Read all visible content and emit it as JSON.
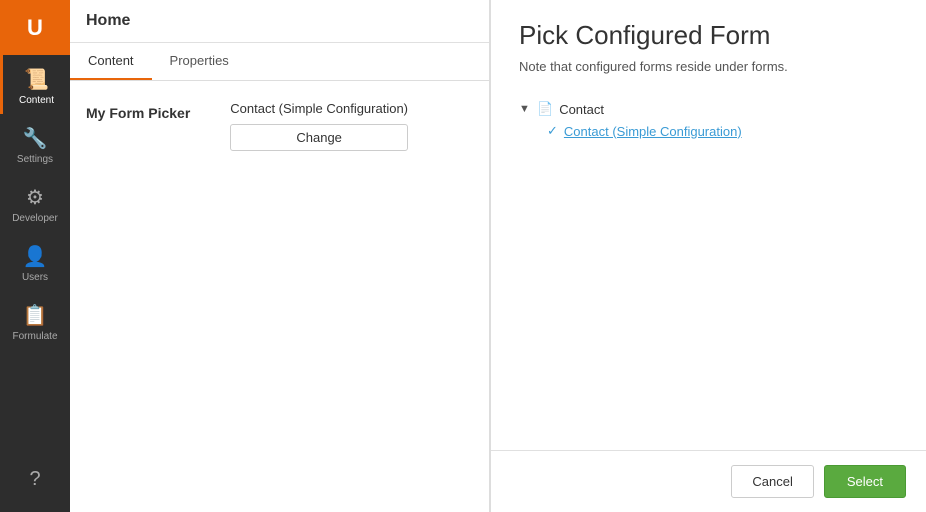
{
  "sidebar": {
    "logo": "U",
    "items": [
      {
        "id": "content",
        "label": "Content",
        "icon": "📄",
        "active": true
      },
      {
        "id": "settings",
        "label": "Settings",
        "icon": "🔧",
        "active": false
      },
      {
        "id": "developer",
        "label": "Developer",
        "icon": "⚙️",
        "active": false
      },
      {
        "id": "users",
        "label": "Users",
        "icon": "👤",
        "active": false
      },
      {
        "id": "formulate",
        "label": "Formulate",
        "icon": "📋",
        "active": false
      }
    ],
    "bottom_icon": "?"
  },
  "main": {
    "page_title": "Home",
    "tabs": [
      {
        "id": "content",
        "label": "Content",
        "active": true
      },
      {
        "id": "properties",
        "label": "Properties",
        "active": false
      }
    ],
    "form_picker": {
      "label": "My Form Picker",
      "current_value": "Contact (Simple Configuration)",
      "change_button": "Change"
    }
  },
  "panel": {
    "title": "Pick Configured Form",
    "subtitle": "Note that configured forms reside under forms.",
    "tree": {
      "root": {
        "toggle": "▼",
        "icon": "📄",
        "label": "Contact"
      },
      "child": {
        "check": "✓",
        "label": "Contact (Simple Configuration)"
      }
    },
    "footer": {
      "cancel_label": "Cancel",
      "select_label": "Select"
    }
  }
}
